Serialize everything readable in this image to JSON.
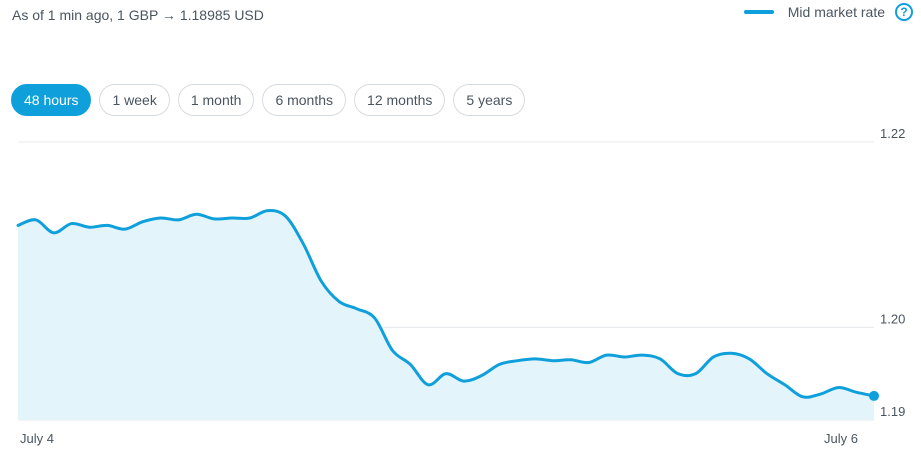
{
  "header": {
    "as_of": "As of 1 min ago, 1 GBP → 1.18985 USD"
  },
  "legend": {
    "label": "Mid market rate",
    "help": "?"
  },
  "tabs": [
    {
      "label": "48 hours",
      "active": true
    },
    {
      "label": "1 week",
      "active": false
    },
    {
      "label": "1 month",
      "active": false
    },
    {
      "label": "6 months",
      "active": false
    },
    {
      "label": "12 months",
      "active": false
    },
    {
      "label": "5 years",
      "active": false
    }
  ],
  "colors": {
    "accent": "#0fa0dc",
    "fill": "#e4f4fb",
    "grid": "#e6e9ec"
  },
  "chart_data": {
    "type": "area",
    "title": "",
    "series": [
      {
        "name": "Mid market rate",
        "values": [
          1.211,
          1.2116,
          1.2102,
          1.2112,
          1.2108,
          1.211,
          1.2106,
          1.2114,
          1.2118,
          1.2116,
          1.2122,
          1.2117,
          1.2118,
          1.2118,
          1.2126,
          1.212,
          1.209,
          1.205,
          1.2028,
          1.202,
          1.201,
          1.1975,
          1.196,
          1.1938,
          1.195,
          1.1942,
          1.1948,
          1.196,
          1.1964,
          1.1966,
          1.1964,
          1.1965,
          1.1962,
          1.197,
          1.1968,
          1.197,
          1.1966,
          1.195,
          1.195,
          1.1968,
          1.1972,
          1.1966,
          1.195,
          1.1938,
          1.1925,
          1.1928,
          1.1935,
          1.193,
          1.1926
        ]
      }
    ],
    "x_tick_labels": [
      "July 4",
      "July 6"
    ],
    "y_ticks": [
      1.19,
      1.2,
      1.22
    ],
    "y_tick_labels": [
      "1.19",
      "1.20",
      "1.22"
    ],
    "ylim": [
      1.19,
      1.22
    ],
    "grid": true,
    "last_point_marker": true
  }
}
